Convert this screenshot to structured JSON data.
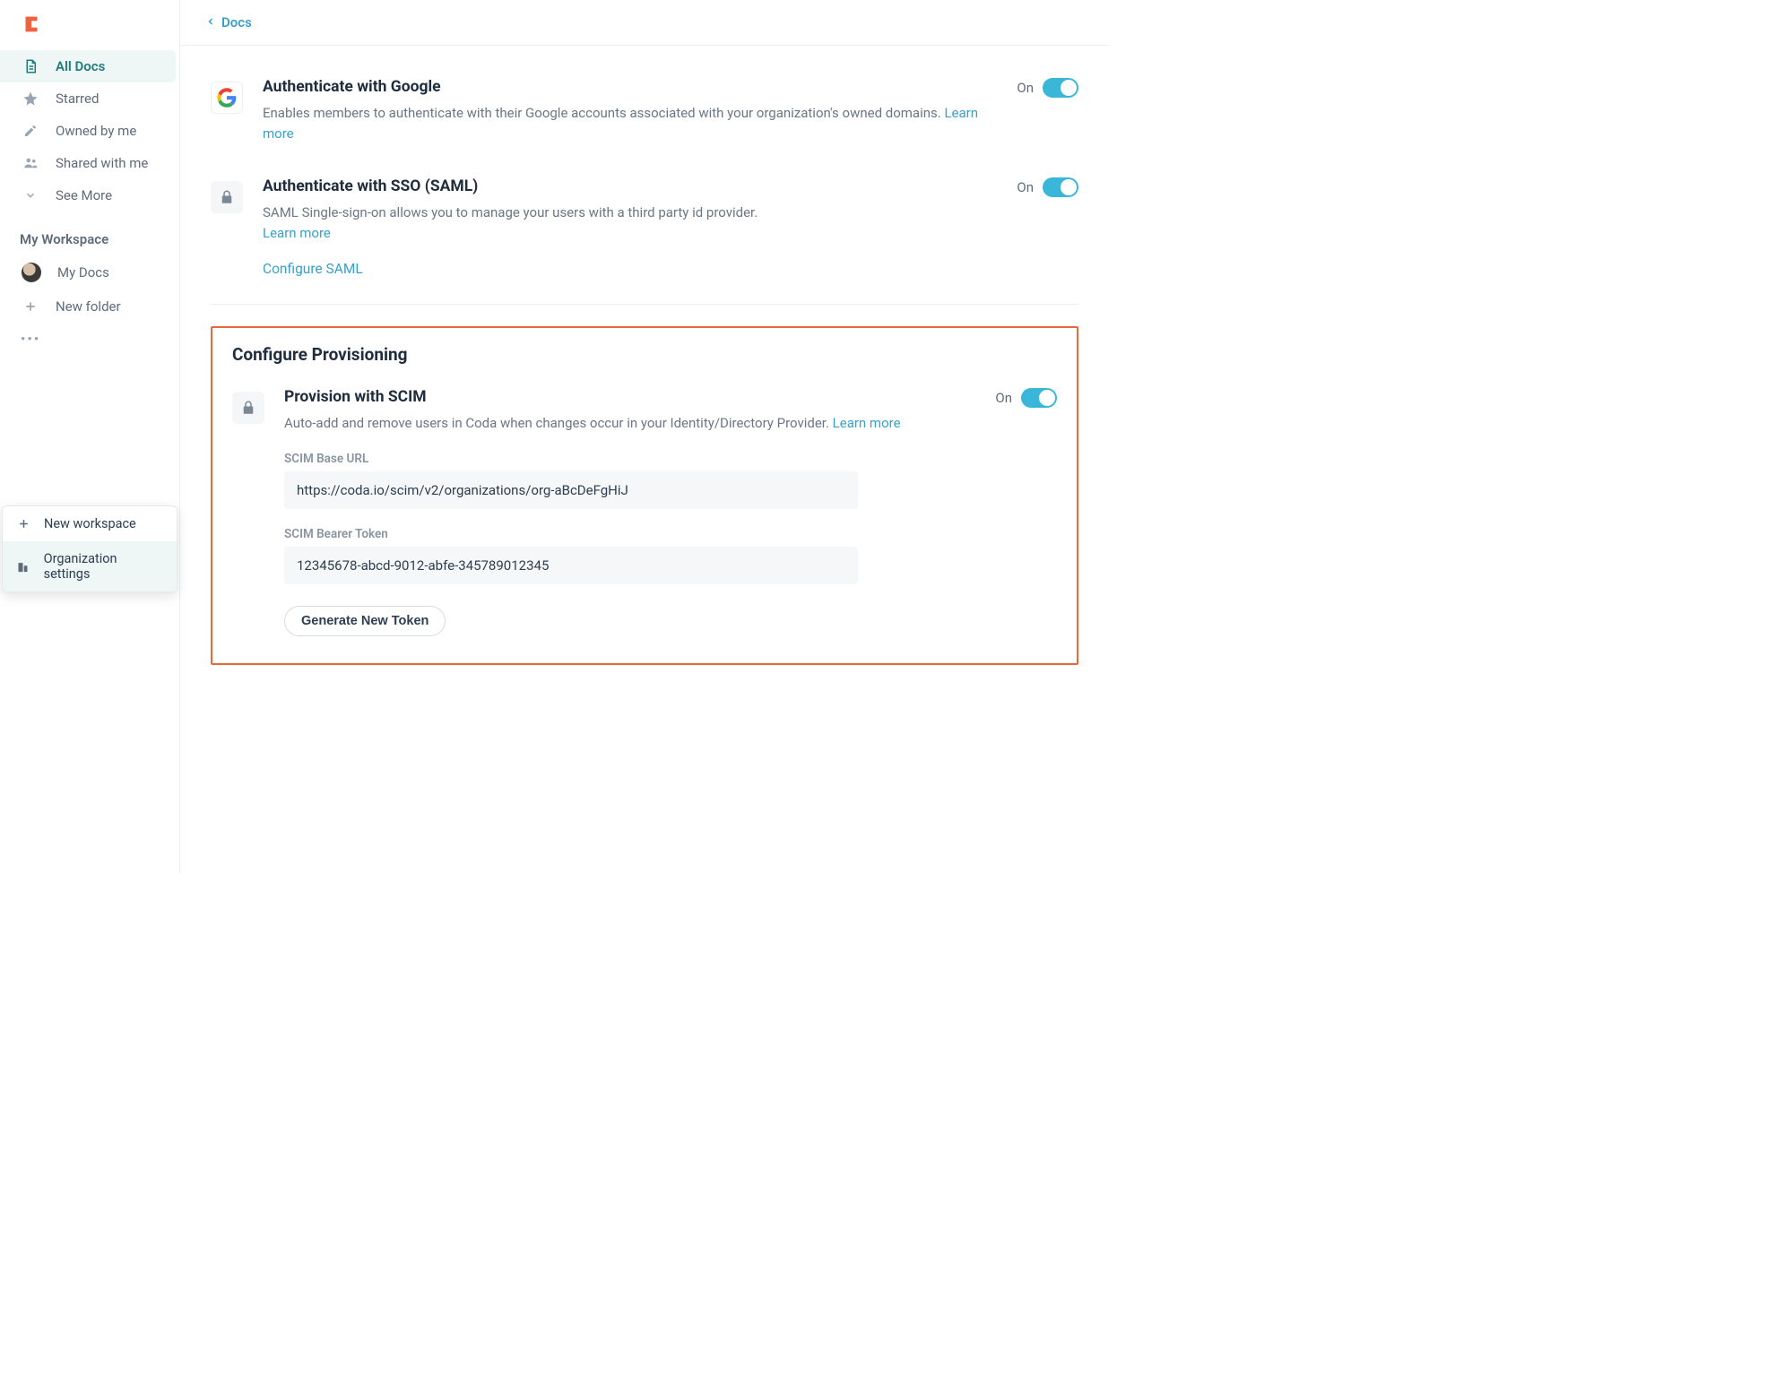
{
  "sidebar": {
    "items": [
      {
        "label": "All Docs",
        "icon": "doc-icon",
        "active": true
      },
      {
        "label": "Starred",
        "icon": "star-icon",
        "active": false
      },
      {
        "label": "Owned by me",
        "icon": "pencil-icon",
        "active": false
      },
      {
        "label": "Shared with me",
        "icon": "people-icon",
        "active": false
      },
      {
        "label": "See More",
        "icon": "chevron-down-icon",
        "active": false
      }
    ],
    "workspace_header": "My Workspace",
    "workspace_items": [
      {
        "label": "My Docs",
        "icon": "avatar"
      },
      {
        "label": "New folder",
        "icon": "plus-icon"
      }
    ],
    "popup": [
      {
        "label": "New workspace",
        "icon": "plus-icon",
        "selected": false
      },
      {
        "label": "Organization settings",
        "icon": "building-icon",
        "selected": true
      }
    ]
  },
  "breadcrumb": {
    "label": "Docs"
  },
  "auth_google": {
    "title": "Authenticate with Google",
    "desc": "Enables members to authenticate with their Google accounts associated with your organization's owned domains. ",
    "learn_more": "Learn more",
    "state": "On"
  },
  "auth_sso": {
    "title": "Authenticate with SSO (SAML)",
    "desc": "SAML Single-sign-on allows you to manage your users with a third party id provider. ",
    "learn_more": "Learn more",
    "configure": "Configure SAML",
    "state": "On"
  },
  "provisioning": {
    "heading": "Configure Provisioning",
    "title": "Provision with SCIM",
    "desc": "Auto-add and remove users in Coda when changes occur in your Identity/Directory Provider. ",
    "learn_more": "Learn more",
    "state": "On",
    "base_url_label": "SCIM Base URL",
    "base_url_value": "https://coda.io/scim/v2/organizations/org-aBcDeFgHiJ",
    "token_label": "SCIM Bearer Token",
    "token_value": "12345678-abcd-9012-abfe-345789012345",
    "generate_btn": "Generate New Token"
  }
}
